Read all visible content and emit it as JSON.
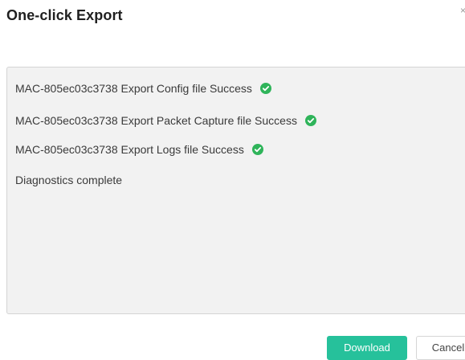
{
  "dialog": {
    "title": "One-click Export",
    "close_glyph": "×"
  },
  "log": {
    "lines": [
      {
        "text": "MAC-805ec03c3738 Export Config file Success",
        "status_icon": "check-circle-icon"
      },
      {
        "text": "MAC-805ec03c3738 Export Packet Capture file Success",
        "status_icon": "check-circle-icon"
      },
      {
        "text": "MAC-805ec03c3738 Export Logs file Success",
        "status_icon": "check-circle-icon"
      }
    ],
    "summary": "Diagnostics complete"
  },
  "buttons": {
    "download_label": "Download",
    "cancel_label": "Cancel"
  },
  "colors": {
    "success": "#2fb45a",
    "primary": "#26c19b",
    "panel_background": "#f2f2f2"
  }
}
